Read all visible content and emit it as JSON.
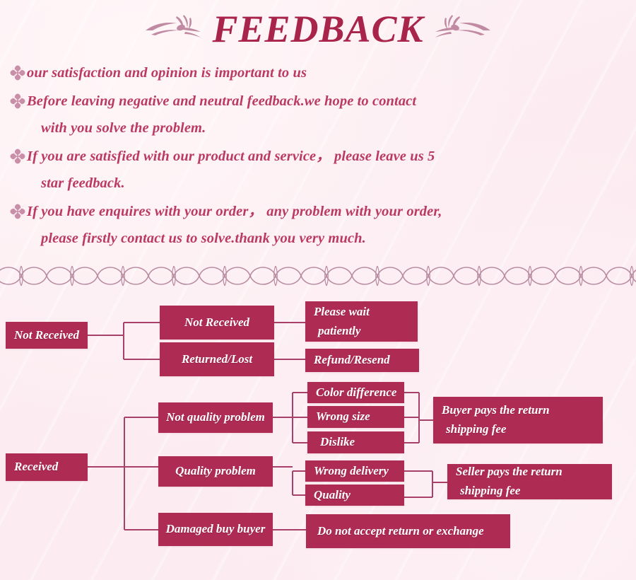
{
  "header": {
    "title": "FEEDBACK",
    "ornament_left": "floral-swirl-ornament",
    "ornament_right": "floral-swirl-ornament"
  },
  "bullets": {
    "icon": "flower-bullet-icon",
    "items": [
      {
        "line1": "our satisfaction and opinion is important to us",
        "line2": ""
      },
      {
        "line1": "Before leaving negative and neutral feedback.we hope to contact",
        "line2": "with you solve the problem."
      },
      {
        "line1": "If you are satisfied with our product and service， please leave us 5",
        "line2": "star feedback."
      },
      {
        "line1": "If you have enquires with your order， any problem with your order,",
        "line2": "please firstly contact us to solve.thank you very much."
      }
    ]
  },
  "divider": {
    "name": "decorative-wave-divider"
  },
  "flowchart": {
    "nodes": {
      "not_received_root": "Not Received",
      "not_received_branch": "Not Received",
      "returned_lost": "Returned/Lost",
      "please_wait_l1": "Please wait",
      "please_wait_l2": "patiently",
      "refund_resend": "Refund/Resend",
      "received_root": "Received",
      "not_quality_problem": "Not quality problem",
      "quality_problem": "Quality problem",
      "damaged_buy_buyer": "Damaged buy buyer",
      "color_difference": "Color difference",
      "wrong_size": "Wrong size",
      "dislike": "Dislike",
      "wrong_delivery": "Wrong delivery",
      "quality": "Quality",
      "buyer_pays_l1": "Buyer pays the return",
      "buyer_pays_l2": "shipping fee",
      "seller_pays_l1": "Seller pays the return",
      "seller_pays_l2": "shipping fee",
      "do_not_accept": "Do not accept return or exchange"
    }
  },
  "colors": {
    "background": "#fbeaf0",
    "node_fill": "#ae2b53",
    "node_text": "#ffffff",
    "heading": "#a9244b",
    "body_text": "#bb3a63",
    "connector": "#a8406a",
    "ornament": "#c98fa8"
  }
}
